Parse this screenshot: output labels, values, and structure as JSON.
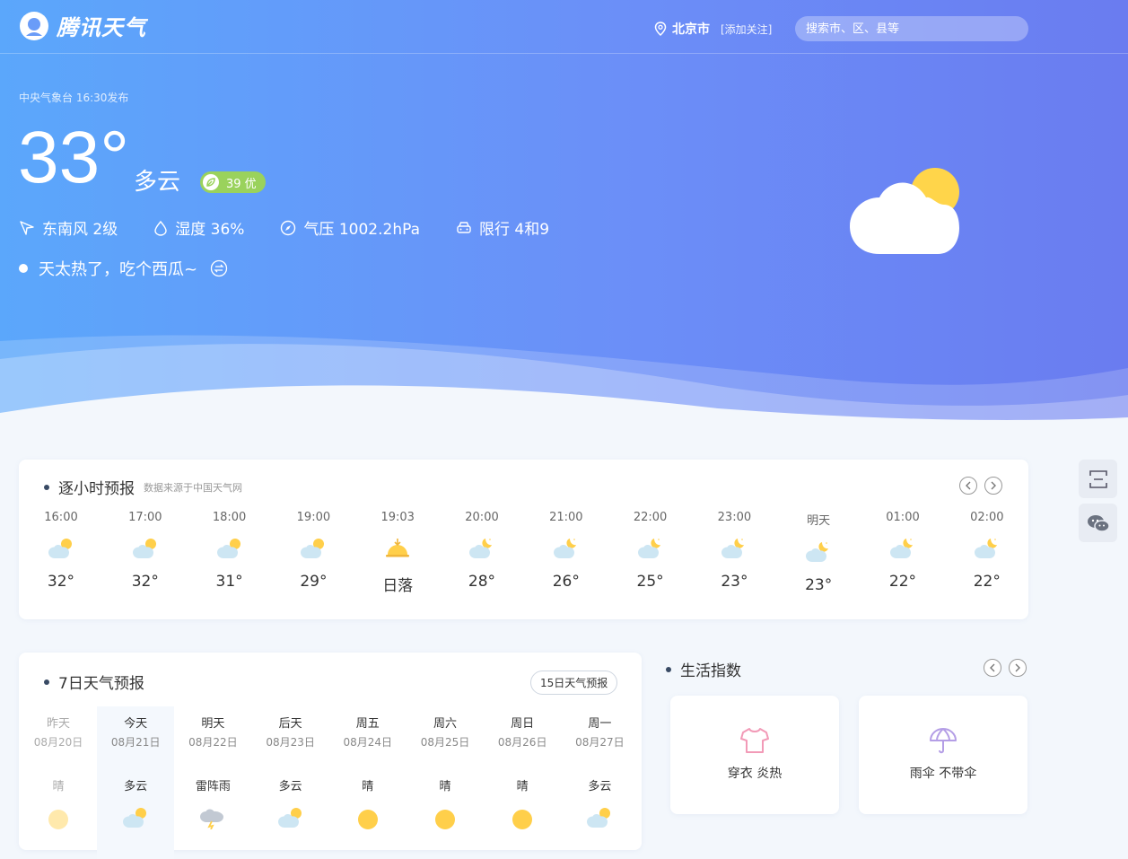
{
  "header": {
    "logo_text": "腾讯天气",
    "city": "北京市",
    "follow_label": "[添加关注]",
    "search_placeholder": "搜索市、区、县等"
  },
  "current": {
    "publish": "中央气象台 16:30发布",
    "temp": "33°",
    "condition": "多云",
    "aqi": "39 优",
    "wind": "东南风 2级",
    "humidity": "湿度 36%",
    "pressure": "气压 1002.2hPa",
    "restriction": "限行 4和9",
    "tip": "天太热了，吃个西瓜~"
  },
  "hourly": {
    "title": "逐小时预报",
    "subtitle": "数据来源于中国天气网",
    "items": [
      {
        "time": "16:00",
        "temp": "32°",
        "icon": "partly-cloudy-day-icon"
      },
      {
        "time": "17:00",
        "temp": "32°",
        "icon": "partly-cloudy-day-icon"
      },
      {
        "time": "18:00",
        "temp": "31°",
        "icon": "partly-cloudy-day-icon"
      },
      {
        "time": "19:00",
        "temp": "29°",
        "icon": "partly-cloudy-day-icon"
      },
      {
        "time": "19:03",
        "temp": "日落",
        "icon": "sunset-icon"
      },
      {
        "time": "20:00",
        "temp": "28°",
        "icon": "partly-cloudy-night-icon"
      },
      {
        "time": "21:00",
        "temp": "26°",
        "icon": "partly-cloudy-night-icon"
      },
      {
        "time": "22:00",
        "temp": "25°",
        "icon": "partly-cloudy-night-icon"
      },
      {
        "time": "23:00",
        "temp": "23°",
        "icon": "partly-cloudy-night-icon"
      },
      {
        "time": "明天",
        "temp": "23°",
        "icon": "partly-cloudy-night-icon"
      },
      {
        "time": "01:00",
        "temp": "22°",
        "icon": "partly-cloudy-night-icon"
      },
      {
        "time": "02:00",
        "temp": "22°",
        "icon": "partly-cloudy-night-icon"
      }
    ]
  },
  "daily": {
    "title": "7日天气预报",
    "button": "15日天气预报",
    "items": [
      {
        "name": "昨天",
        "date": "08月20日",
        "cond": "晴",
        "icon": "sunny-icon"
      },
      {
        "name": "今天",
        "date": "08月21日",
        "cond": "多云",
        "icon": "partly-cloudy-day-icon"
      },
      {
        "name": "明天",
        "date": "08月22日",
        "cond": "雷阵雨",
        "icon": "thunderstorm-icon"
      },
      {
        "name": "后天",
        "date": "08月23日",
        "cond": "多云",
        "icon": "partly-cloudy-day-icon"
      },
      {
        "name": "周五",
        "date": "08月24日",
        "cond": "晴",
        "icon": "sunny-icon"
      },
      {
        "name": "周六",
        "date": "08月25日",
        "cond": "晴",
        "icon": "sunny-icon"
      },
      {
        "name": "周日",
        "date": "08月26日",
        "cond": "晴",
        "icon": "sunny-icon"
      },
      {
        "name": "周一",
        "date": "08月27日",
        "cond": "多云",
        "icon": "partly-cloudy-day-icon"
      }
    ]
  },
  "life": {
    "title": "生活指数",
    "items": [
      {
        "label": "穿衣 炎热",
        "icon": "shirt-icon"
      },
      {
        "label": "雨伞 不带伞",
        "icon": "umbrella-icon"
      }
    ]
  },
  "colors": {
    "hero_left": "#5ba7fb",
    "hero_right": "#6a7cf0",
    "aqi_good": "#9ad25c",
    "sun": "#ffcf4a",
    "cloud": "#cfe6f2"
  }
}
